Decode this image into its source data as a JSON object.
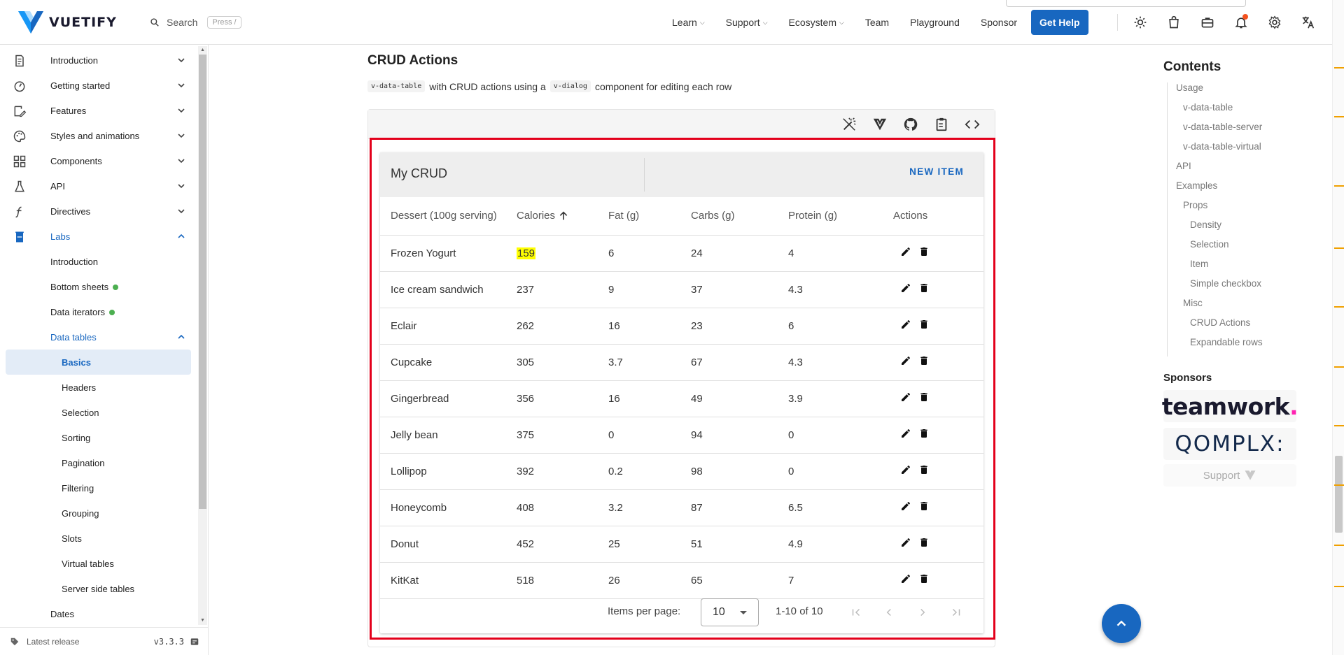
{
  "header": {
    "logo_text": "VUETIFY",
    "search_label": "Search",
    "search_shortcut": "Press /",
    "nav": [
      {
        "label": "Learn",
        "dropdown": true
      },
      {
        "label": "Support",
        "dropdown": true
      },
      {
        "label": "Ecosystem",
        "dropdown": true
      },
      {
        "label": "Team",
        "dropdown": false
      },
      {
        "label": "Playground",
        "dropdown": false
      },
      {
        "label": "Sponsor",
        "dropdown": false
      }
    ],
    "get_help_label": "Get Help",
    "accent_color": "#1867c0",
    "icons": [
      "theme-icon",
      "store-icon",
      "jobs-icon",
      "notifications-icon",
      "settings-icon",
      "language-icon"
    ]
  },
  "sidebar": {
    "items": [
      {
        "label": "Introduction",
        "icon": "document-icon",
        "expanded": false
      },
      {
        "label": "Getting started",
        "icon": "speedometer-icon",
        "expanded": false
      },
      {
        "label": "Features",
        "icon": "edit-icon",
        "expanded": false
      },
      {
        "label": "Styles and animations",
        "icon": "palette-icon",
        "expanded": false
      },
      {
        "label": "Components",
        "icon": "components-icon",
        "expanded": false
      },
      {
        "label": "API",
        "icon": "flask-icon",
        "expanded": false
      },
      {
        "label": "Directives",
        "icon": "function-icon",
        "expanded": false
      },
      {
        "label": "Labs",
        "icon": "beaker-icon",
        "expanded": true
      }
    ],
    "labs_children": [
      {
        "label": "Introduction",
        "badge": false
      },
      {
        "label": "Bottom sheets",
        "badge": true
      },
      {
        "label": "Data iterators",
        "badge": true
      },
      {
        "label": "Data tables",
        "badge": false,
        "expanded": true
      }
    ],
    "data_tables_children": [
      "Basics",
      "Headers",
      "Selection",
      "Sorting",
      "Pagination",
      "Filtering",
      "Grouping",
      "Slots",
      "Virtual tables",
      "Server side tables"
    ],
    "selected": "Basics",
    "after": [
      "Dates"
    ],
    "footer": {
      "label": "Latest release",
      "version": "v3.3.3"
    }
  },
  "main": {
    "section_title": "CRUD Actions",
    "description": {
      "code1": "v-data-table",
      "text1": "with CRUD actions using a",
      "code2": "v-dialog",
      "text2": "component for editing each row"
    },
    "toolbar_icons": [
      "magic-wand-icon",
      "vuetify-bin-icon",
      "github-icon",
      "clipboard-icon",
      "code-icon"
    ]
  },
  "crud": {
    "title": "My CRUD",
    "new_item_label": "NEW ITEM",
    "headers": [
      "Dessert (100g serving)",
      "Calories",
      "Fat (g)",
      "Carbs (g)",
      "Protein (g)",
      "Actions"
    ],
    "sorted_by": "Calories",
    "rows": [
      [
        "Frozen Yogurt",
        "159",
        "6",
        "24",
        "4"
      ],
      [
        "Ice cream sandwich",
        "237",
        "9",
        "37",
        "4.3"
      ],
      [
        "Eclair",
        "262",
        "16",
        "23",
        "6"
      ],
      [
        "Cupcake",
        "305",
        "3.7",
        "67",
        "4.3"
      ],
      [
        "Gingerbread",
        "356",
        "16",
        "49",
        "3.9"
      ],
      [
        "Jelly bean",
        "375",
        "0",
        "94",
        "0"
      ],
      [
        "Lollipop",
        "392",
        "0.2",
        "98",
        "0"
      ],
      [
        "Honeycomb",
        "408",
        "3.2",
        "87",
        "6.5"
      ],
      [
        "Donut",
        "452",
        "25",
        "51",
        "4.9"
      ],
      [
        "KitKat",
        "518",
        "26",
        "65",
        "7"
      ]
    ],
    "highlighted_cell": "159",
    "items_per_page_label": "Items per page:",
    "items_per_page_value": "10",
    "range_text": "1-10 of 10"
  },
  "toc": {
    "title": "Contents",
    "items": [
      {
        "label": "Usage",
        "level": 1
      },
      {
        "label": "v-data-table",
        "level": 2
      },
      {
        "label": "v-data-table-server",
        "level": 2
      },
      {
        "label": "v-data-table-virtual",
        "level": 2
      },
      {
        "label": "API",
        "level": 1
      },
      {
        "label": "Examples",
        "level": 1
      },
      {
        "label": "Props",
        "level": 2
      },
      {
        "label": "Density",
        "level": 3
      },
      {
        "label": "Selection",
        "level": 3
      },
      {
        "label": "Item",
        "level": 3
      },
      {
        "label": "Simple checkbox",
        "level": 3
      },
      {
        "label": "Misc",
        "level": 2
      },
      {
        "label": "CRUD Actions",
        "level": 3
      },
      {
        "label": "Expandable rows",
        "level": 3
      }
    ],
    "sponsors_title": "Sponsors",
    "sponsors": [
      "teamwork",
      "QOMPLX:"
    ],
    "support_label": "Support"
  }
}
